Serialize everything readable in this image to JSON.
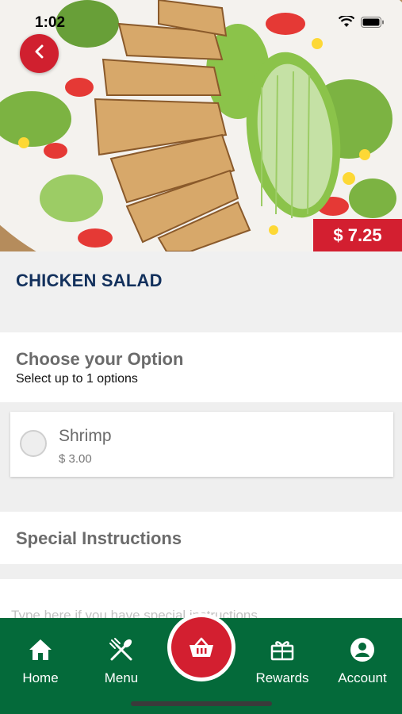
{
  "status": {
    "time": "1:02"
  },
  "item": {
    "title": "CHICKEN SALAD",
    "price": "$ 7.25"
  },
  "options_section": {
    "title": "Choose your Option",
    "subtitle": "Select up to 1 options",
    "options": [
      {
        "name": "Shrimp",
        "price": "$ 3.00",
        "selected": false
      }
    ]
  },
  "instructions": {
    "title": "Special Instructions",
    "placeholder": "Type here if you have special instructions"
  },
  "tabbar": {
    "items": [
      {
        "label": "Home",
        "icon": "home-icon"
      },
      {
        "label": "Menu",
        "icon": "utensils-icon"
      },
      {
        "label": "",
        "icon": "basket-icon"
      },
      {
        "label": "Rewards",
        "icon": "gift-icon"
      },
      {
        "label": "Account",
        "icon": "account-icon"
      }
    ]
  },
  "colors": {
    "brand_red": "#d31f30",
    "brand_green": "#046a3a",
    "title_navy": "#12305c"
  }
}
